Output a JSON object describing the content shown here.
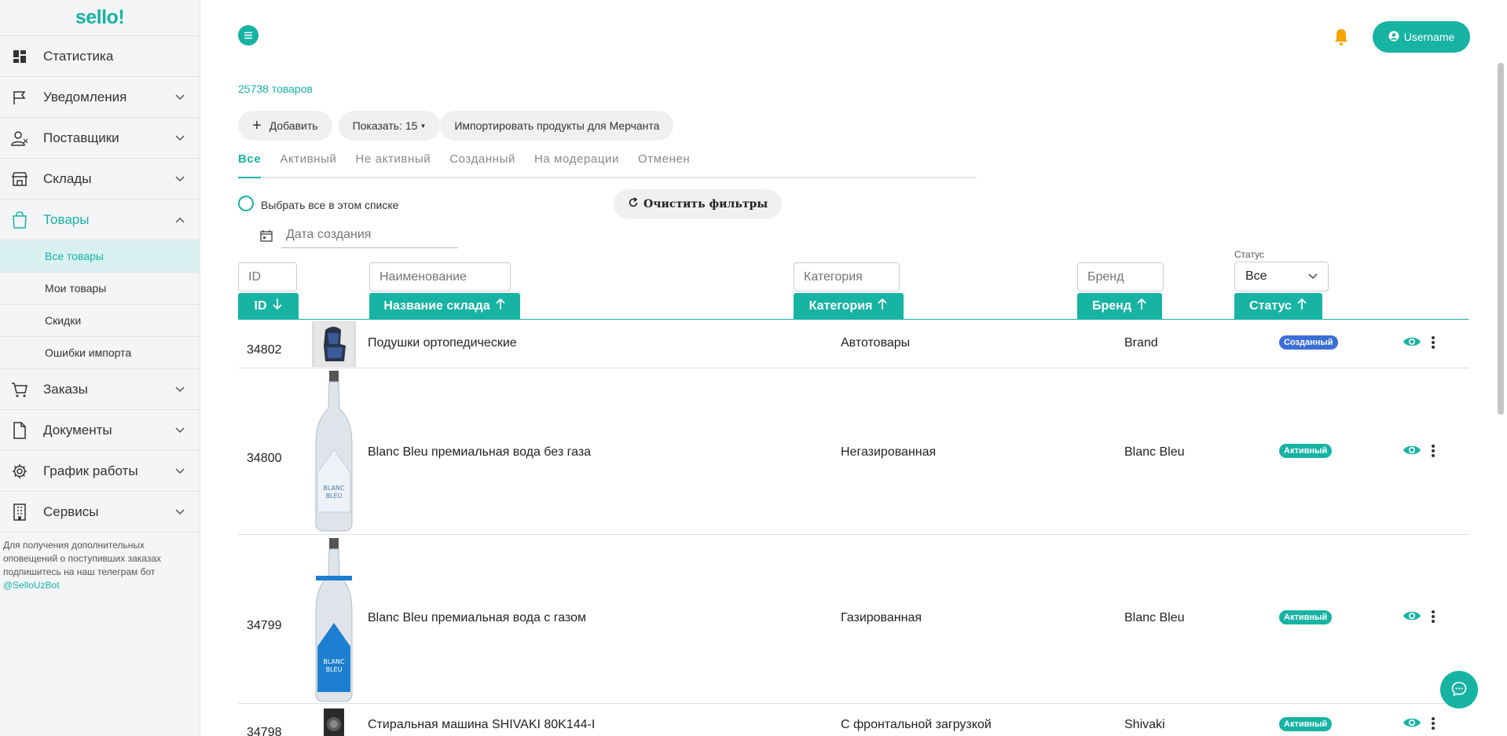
{
  "brand": {
    "logo": "sello!",
    "accent": "#17b3a3"
  },
  "sidebar": {
    "items": [
      {
        "label": "Статистика",
        "icon": "dashboard-icon"
      },
      {
        "label": "Уведомления",
        "icon": "flag-icon"
      },
      {
        "label": "Поставщики",
        "icon": "user-icon"
      },
      {
        "label": "Склады",
        "icon": "store-icon"
      },
      {
        "label": "Товары",
        "icon": "bag-icon"
      }
    ],
    "subitems": [
      {
        "label": "Все товары"
      },
      {
        "label": "Мои товары"
      },
      {
        "label": "Скидки"
      },
      {
        "label": "Ошибки импорта"
      }
    ],
    "items2": [
      {
        "label": "Заказы",
        "icon": "cart-icon"
      },
      {
        "label": "Документы",
        "icon": "document-icon"
      },
      {
        "label": "График работы",
        "icon": "gear-icon"
      },
      {
        "label": "Сервисы",
        "icon": "building-icon"
      }
    ],
    "note": "Для получения дополнительных оповещений о поступивших заказах подпишитесь на наш телеграм бот",
    "note_link": "@SelloUzBot"
  },
  "header": {
    "username": "Username"
  },
  "products_count": "25738 товаров",
  "toolbar": {
    "add_label": "Добавить",
    "show_label": "Показать: 15",
    "import_label": "Импортировать продукты для Мерчанта"
  },
  "tabs": [
    "Все",
    "Активный",
    "Не активный",
    "Созданный",
    "На модерации",
    "Отменен"
  ],
  "filters": {
    "select_all": "Выбрать все в этом списке",
    "clear": "Очистить фильтры",
    "date_placeholder": "Дата создания",
    "id_placeholder": "ID",
    "name_placeholder": "Наименование",
    "category_placeholder": "Категория",
    "brand_placeholder": "Бренд",
    "status_label": "Статус",
    "status_value": "Все"
  },
  "columns": {
    "id": "ID",
    "name": "Название склада",
    "category": "Категория",
    "brand": "Бренд",
    "status": "Статус"
  },
  "rows": [
    {
      "id": "34802",
      "name": "Подушки ортопедические",
      "category": "Автотовары",
      "brand": "Brand",
      "status": "Созданный",
      "status_color": "#3b6fd6"
    },
    {
      "id": "34800",
      "name": "Blanc Bleu премиальная вода без газа",
      "category": "Негазированная",
      "brand": "Blanc Bleu",
      "status": "Активный",
      "status_color": "#17b3a3",
      "image_text": "BLANC\nBLEU"
    },
    {
      "id": "34799",
      "name": "Blanc Bleu премиальная вода с газом",
      "category": "Газированная",
      "brand": "Blanc Bleu",
      "status": "Активный",
      "status_color": "#17b3a3",
      "image_text": "BLANC\nBLEU"
    },
    {
      "id": "34798",
      "name": "Стиральная машина SHIVAKI 80K144-I",
      "category": "С фронтальной загрузкой",
      "brand": "Shivaki",
      "status": "Активный",
      "status_color": "#17b3a3"
    }
  ]
}
